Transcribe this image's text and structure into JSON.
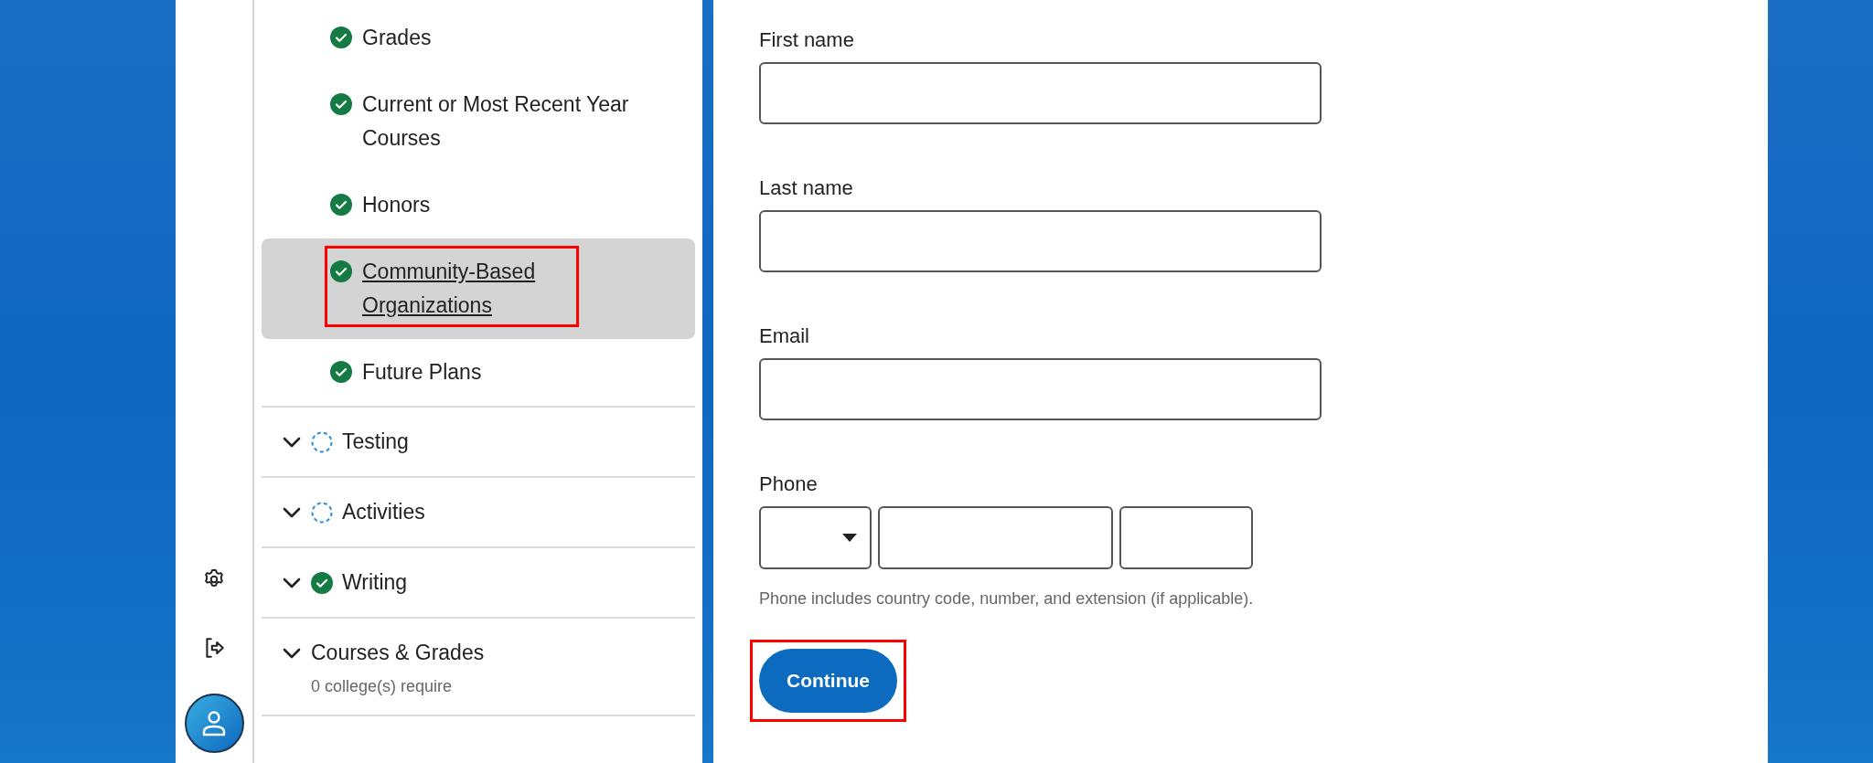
{
  "sidebar": {
    "subitems": [
      {
        "label": "Grades",
        "kind": "complete",
        "selected": false,
        "highlighted": false
      },
      {
        "label": "Current or Most Recent Year Courses",
        "kind": "complete",
        "selected": false,
        "highlighted": false
      },
      {
        "label": "Honors",
        "kind": "complete",
        "selected": false,
        "highlighted": false
      },
      {
        "label": "Community-Based Organizations",
        "kind": "complete",
        "selected": true,
        "highlighted": true
      },
      {
        "label": "Future Plans",
        "kind": "complete",
        "selected": false,
        "highlighted": false
      }
    ],
    "sections": [
      {
        "label": "Testing",
        "kind": "pending"
      },
      {
        "label": "Activities",
        "kind": "pending"
      },
      {
        "label": "Writing",
        "kind": "complete"
      },
      {
        "label": "Courses & Grades",
        "kind": "plain",
        "note": "0 college(s) require"
      }
    ]
  },
  "form": {
    "fields": [
      {
        "label": "First name",
        "kind": "text"
      },
      {
        "label": "Last name",
        "kind": "text"
      },
      {
        "label": "Email",
        "kind": "text"
      },
      {
        "label": "Phone",
        "kind": "phone",
        "hint": "Phone includes country code, number, and extension (if applicable)."
      }
    ],
    "continue_button": {
      "label": "Continue",
      "highlighted": true
    }
  }
}
